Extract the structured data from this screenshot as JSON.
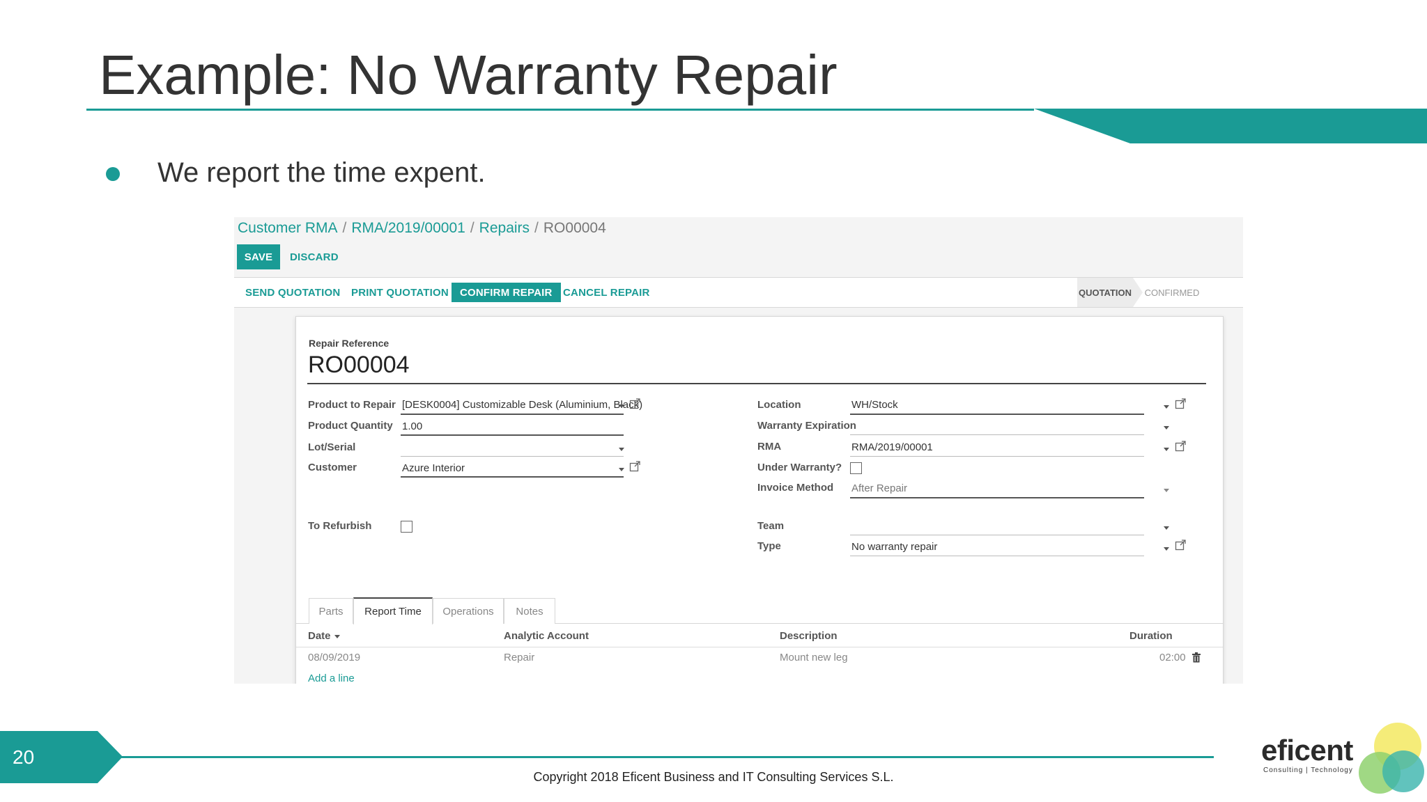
{
  "slide": {
    "title": "Example: No Warranty Repair",
    "bullet": "We report the time expent.",
    "page_number": "20",
    "copyright": "Copyright 2018 Eficent Business and IT Consulting Services S.L.",
    "logo_word": "eficent",
    "logo_sub": "Consulting | Technology",
    "accent_color": "#1a9b95"
  },
  "breadcrumb": {
    "items": [
      "Customer RMA",
      "RMA/2019/00001",
      "Repairs"
    ],
    "current": "RO00004",
    "separator": "/"
  },
  "controls": {
    "save": "SAVE",
    "discard": "DISCARD"
  },
  "actions": {
    "send_quotation": "SEND QUOTATION",
    "print_quotation": "PRINT QUOTATION",
    "confirm_repair": "CONFIRM REPAIR",
    "cancel_repair": "CANCEL REPAIR"
  },
  "stages": {
    "active": "QUOTATION",
    "next": "CONFIRMED"
  },
  "form": {
    "reference_label": "Repair Reference",
    "reference_value": "RO00004",
    "left": {
      "product_label": "Product to Repair",
      "product_value": "[DESK0004] Customizable Desk (Aluminium, Black)",
      "quantity_label": "Product Quantity",
      "quantity_value": "1.00",
      "lot_label": "Lot/Serial",
      "lot_value": "",
      "customer_label": "Customer",
      "customer_value": "Azure Interior",
      "refurbish_label": "To Refurbish"
    },
    "right": {
      "location_label": "Location",
      "location_value": "WH/Stock",
      "warranty_exp_label": "Warranty Expiration",
      "warranty_exp_value": "",
      "rma_label": "RMA",
      "rma_value": "RMA/2019/00001",
      "under_warranty_label": "Under Warranty?",
      "invoice_label": "Invoice Method",
      "invoice_value": "After Repair",
      "team_label": "Team",
      "team_value": "",
      "type_label": "Type",
      "type_value": "No warranty repair"
    }
  },
  "tabs": [
    "Parts",
    "Report Time",
    "Operations",
    "Notes"
  ],
  "active_tab": "Report Time",
  "table": {
    "headers": {
      "date": "Date",
      "account": "Analytic Account",
      "description": "Description",
      "duration": "Duration"
    },
    "rows": [
      {
        "date": "08/09/2019",
        "account": "Repair",
        "description": "Mount new leg",
        "duration": "02:00"
      }
    ],
    "add_line": "Add a line"
  }
}
